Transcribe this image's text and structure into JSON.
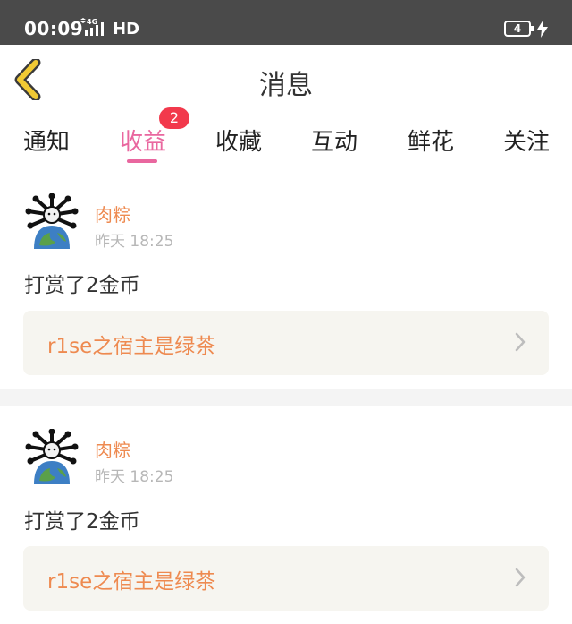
{
  "status_bar": {
    "time": "00:09",
    "network": "4G",
    "hd": "HD",
    "battery": "4"
  },
  "nav": {
    "title": "消息",
    "back_icon": "chevron-left-icon"
  },
  "tabs": [
    {
      "label": "通知",
      "active": false
    },
    {
      "label": "收益",
      "active": true,
      "badge": "2"
    },
    {
      "label": "收藏",
      "active": false
    },
    {
      "label": "互动",
      "active": false
    },
    {
      "label": "鲜花",
      "active": false
    },
    {
      "label": "关注",
      "active": false
    }
  ],
  "messages": [
    {
      "username": "肉粽",
      "time": "昨天 18:25",
      "text": "打赏了2金币",
      "link_text": "r1se之宿主是绿茶"
    },
    {
      "username": "肉粽",
      "time": "昨天 18:25",
      "text": "打赏了2金币",
      "link_text": "r1se之宿主是绿茶"
    }
  ],
  "colors": {
    "accent": "#e9679f",
    "badge": "#f2394c",
    "username": "#ee8a50",
    "back_icon": "#f0c934",
    "status_bar": "#4a4a4a"
  }
}
